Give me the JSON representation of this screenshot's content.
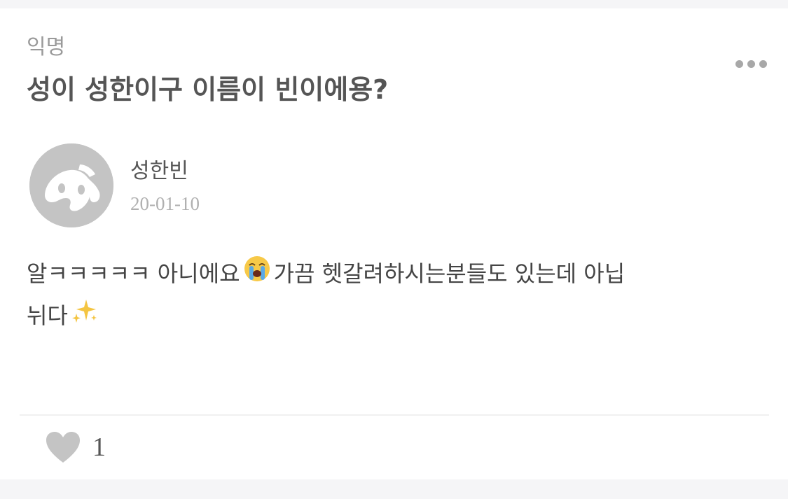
{
  "post": {
    "category": "익명",
    "title": "성이 성한이구 이름이 빈이에용?",
    "author": "성한빈",
    "date": "20-01-10",
    "body_line1_a": "알ㅋㅋㅋㅋㅋ 아니에요",
    "body_line1_b": "가끔 헷갈려하시는분들도 있는데 아닙",
    "body_line2": "뉘다"
  },
  "reactions": {
    "like_count": "1"
  },
  "icons": {
    "more": "more-options-icon",
    "avatar": "anonymous-avatar-icon",
    "crying": "loudly-crying-face-emoji",
    "sparkles": "sparkles-emoji",
    "like": "heart-icon"
  },
  "colors": {
    "title": "#555555",
    "muted": "#9a9a9a",
    "avatar": "#c4c4c4",
    "heart": "#c4c4c4",
    "sparkle": "#f4c542"
  }
}
